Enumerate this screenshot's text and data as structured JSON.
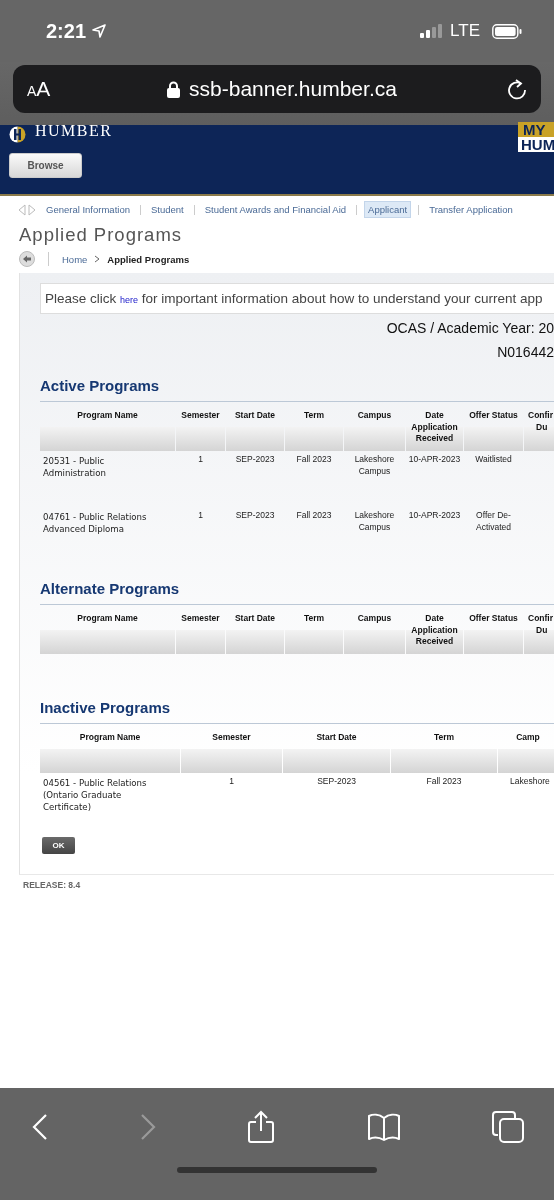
{
  "status_bar": {
    "time": "2:21",
    "network": "LTE"
  },
  "address_bar": {
    "reader_button": "AA",
    "url": "ssb-banner.humber.ca"
  },
  "header": {
    "brand": "HUMBER",
    "corner_logo": [
      "MY",
      "HUM"
    ],
    "browse_button": "Browse"
  },
  "nav_tabs": [
    {
      "label": "General Information",
      "selected": false
    },
    {
      "label": "Student",
      "selected": false
    },
    {
      "label": "Student Awards and Financial Aid",
      "selected": false
    },
    {
      "label": "Applicant",
      "selected": true
    },
    {
      "label": "Transfer Application",
      "selected": false
    }
  ],
  "page_title": "Applied Programs",
  "breadcrumb": [
    "Home",
    "Applied Programs"
  ],
  "info_box": {
    "before": "Please click",
    "link": "here",
    "after": "for important information about how to understand your current app"
  },
  "academic_year": "OCAS / Academic Year: 20",
  "student_id": "N016442",
  "sections": [
    {
      "title": "Active Programs",
      "columns": [
        "Program Name",
        "Semester",
        "Start Date",
        "Term",
        "Campus",
        "Date Application Received",
        "Offer Status",
        "Confir Du"
      ],
      "rows": [
        [
          "20531 - Public Administration",
          "1",
          "SEP-2023",
          "Fall 2023",
          "Lakeshore Campus",
          "10-APR-2023",
          "Waitlisted",
          ""
        ],
        [
          "04761 - Public Relations Advanced Diploma",
          "1",
          "SEP-2023",
          "Fall 2023",
          "Lakeshore Campus",
          "10-APR-2023",
          "Offer De-Activated",
          ""
        ]
      ]
    },
    {
      "title": "Alternate Programs",
      "columns": [
        "Program Name",
        "Semester",
        "Start Date",
        "Term",
        "Campus",
        "Date Application Received",
        "Offer Status",
        "Confir Du"
      ]
    },
    {
      "title": "Inactive Programs",
      "columns": [
        "Program Name",
        "Semester",
        "Start Date",
        "Term",
        "Camp"
      ],
      "rows": [
        [
          "04561 - Public Relations (Ontario Graduate Certificate)",
          "1",
          "SEP-2023",
          "Fall 2023",
          "Lakeshore"
        ]
      ]
    }
  ],
  "ok_button": "OK",
  "release": "RELEASE: 8.4",
  "toolbar": [
    {
      "kind": "back",
      "disabled": false
    },
    {
      "kind": "forward",
      "disabled": true
    },
    {
      "kind": "share",
      "disabled": false
    },
    {
      "kind": "bookmarks",
      "disabled": false
    },
    {
      "kind": "tabs",
      "disabled": false
    }
  ]
}
